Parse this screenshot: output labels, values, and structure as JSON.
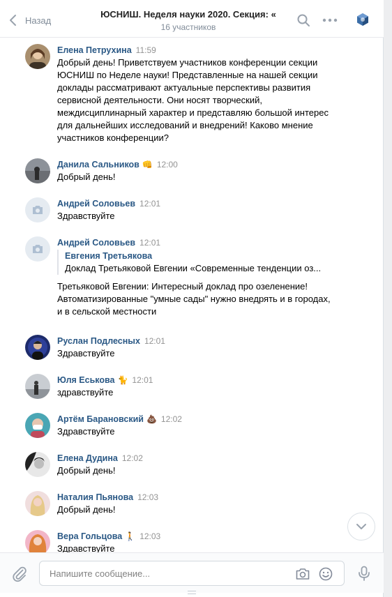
{
  "header": {
    "back_label": "Назад",
    "title": "ЮСНИШ. Неделя науки 2020. Секция: «",
    "subtitle": "16 участников"
  },
  "messages": [
    {
      "author": "Елена Петрухина",
      "time": "11:59",
      "text": "Добрый день! Приветствуем участников конференции секции ЮСНИШ по Неделе науки! Представленные на нашей секции доклады рассматривают актуальные перспективы развития сервисной деятельности. Они носят творческий, междисциплинарный характер и представляю большой интерес для дальнейших исследований и внедрений! Каково мнение участников конференции?"
    },
    {
      "author": "Данила Сальников",
      "emoji": "👊",
      "time": "12:00",
      "text": "Добрый день!"
    },
    {
      "author": "Андрей Соловьев",
      "time": "12:01",
      "text": "Здравствуйте"
    },
    {
      "author": "Андрей Соловьев",
      "time": "12:01",
      "quote_author": "Евгения Третьякова",
      "quote_text": "Доклад Третьяковой Евгении «Современные тенденции оз...",
      "text": "Третьяковой Евгении: Интересный доклад про озеленение! Автоматизированные \"умные сады\" нужно внедрять и в городах, и в сельской местности"
    },
    {
      "author": "Руслан Подлесных",
      "time": "12:01",
      "text": "Здравствуйте"
    },
    {
      "author": "Юля Еськова",
      "emoji": "🐈",
      "time": "12:01",
      "text": "здравствуйте"
    },
    {
      "author": "Артём Барановский",
      "emoji": "💩",
      "time": "12:02",
      "text": "Здравствуйте"
    },
    {
      "author": "Елена Дудина",
      "time": "12:02",
      "text": "Добрый день!"
    },
    {
      "author": "Наталия Пьянова",
      "time": "12:03",
      "text": "Добрый день!"
    },
    {
      "author": "Вера Гольцова",
      "emoji": "🚶",
      "time": "12:03",
      "text": "Здравствуйте"
    }
  ],
  "composer": {
    "placeholder": "Напишите сообщение..."
  },
  "icons": {
    "back": "chevron-left-icon",
    "search": "search-icon",
    "more": "more-horizontal-icon",
    "attach": "paperclip-icon",
    "camera": "camera-icon",
    "smile": "smile-icon",
    "mic": "microphone-icon",
    "scroll_down": "chevron-down-icon"
  },
  "colors": {
    "link": "#2a5885",
    "muted": "#818c99",
    "accent": "#5181b8"
  }
}
